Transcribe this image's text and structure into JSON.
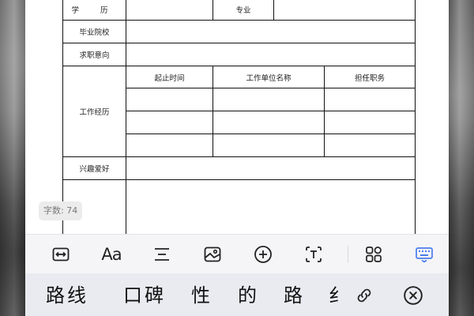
{
  "form": {
    "education_label": "学 历",
    "major_label": "专业",
    "school_label": "毕业院校",
    "intent_label": "求职意向",
    "work_history_label": "工作经历",
    "work_columns": [
      "起止时间",
      "工作单位名称",
      "担任职务"
    ],
    "hobby_label": "兴趣爱好"
  },
  "editor": {
    "char_count": "字数: 74"
  },
  "toolbar": {
    "items": [
      {
        "icon": "expand-horizontal-icon"
      },
      {
        "icon": "text-format-icon",
        "label": "Aa"
      },
      {
        "icon": "paragraph-align-icon"
      },
      {
        "icon": "image-icon"
      },
      {
        "icon": "add-circle-icon"
      },
      {
        "icon": "text-box-icon"
      },
      {
        "icon": "apps-grid-icon"
      },
      {
        "icon": "keyboard-icon"
      }
    ],
    "active_color": "#4a7df0"
  },
  "candidates": {
    "words": [
      "路线",
      "口碑",
      "性",
      "的",
      "路",
      "纟"
    ]
  }
}
